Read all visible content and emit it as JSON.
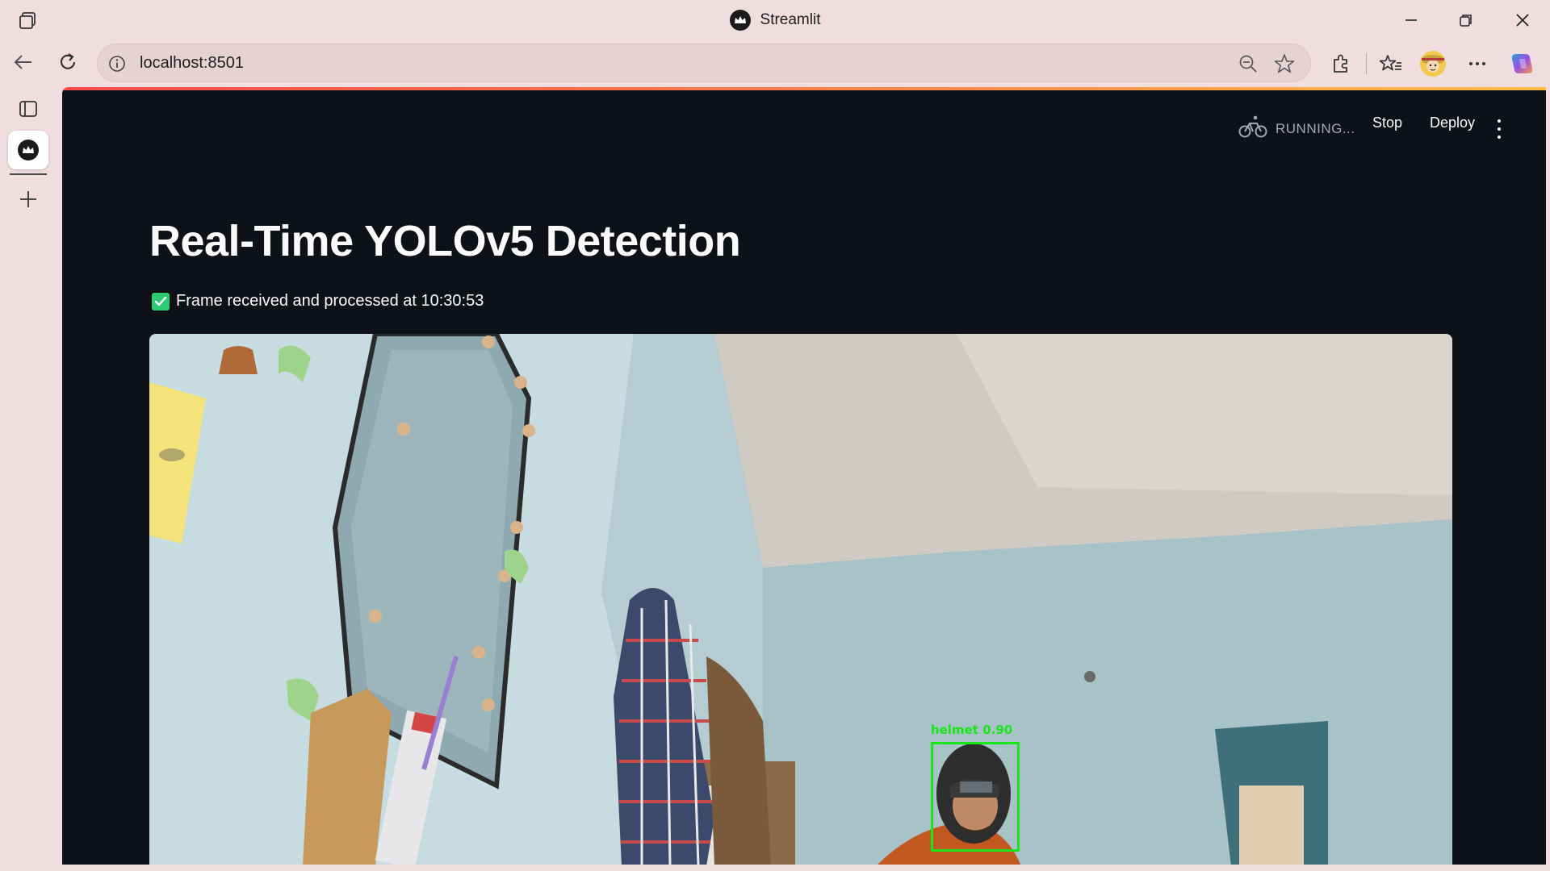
{
  "browser": {
    "window_title": "Streamlit",
    "url": "localhost:8501"
  },
  "app": {
    "status": "RUNNING...",
    "stop_label": "Stop",
    "deploy_label": "Deploy",
    "title": "Real-Time YOLOv5 Detection",
    "status_message": "Frame received and processed at 10:30:53"
  },
  "detection": {
    "label": "helmet 0.90",
    "box_color": "#19e619"
  },
  "colors": {
    "app_background": "#0e1117",
    "browser_chrome": "#f0dde0",
    "success": "#2ecc71"
  }
}
